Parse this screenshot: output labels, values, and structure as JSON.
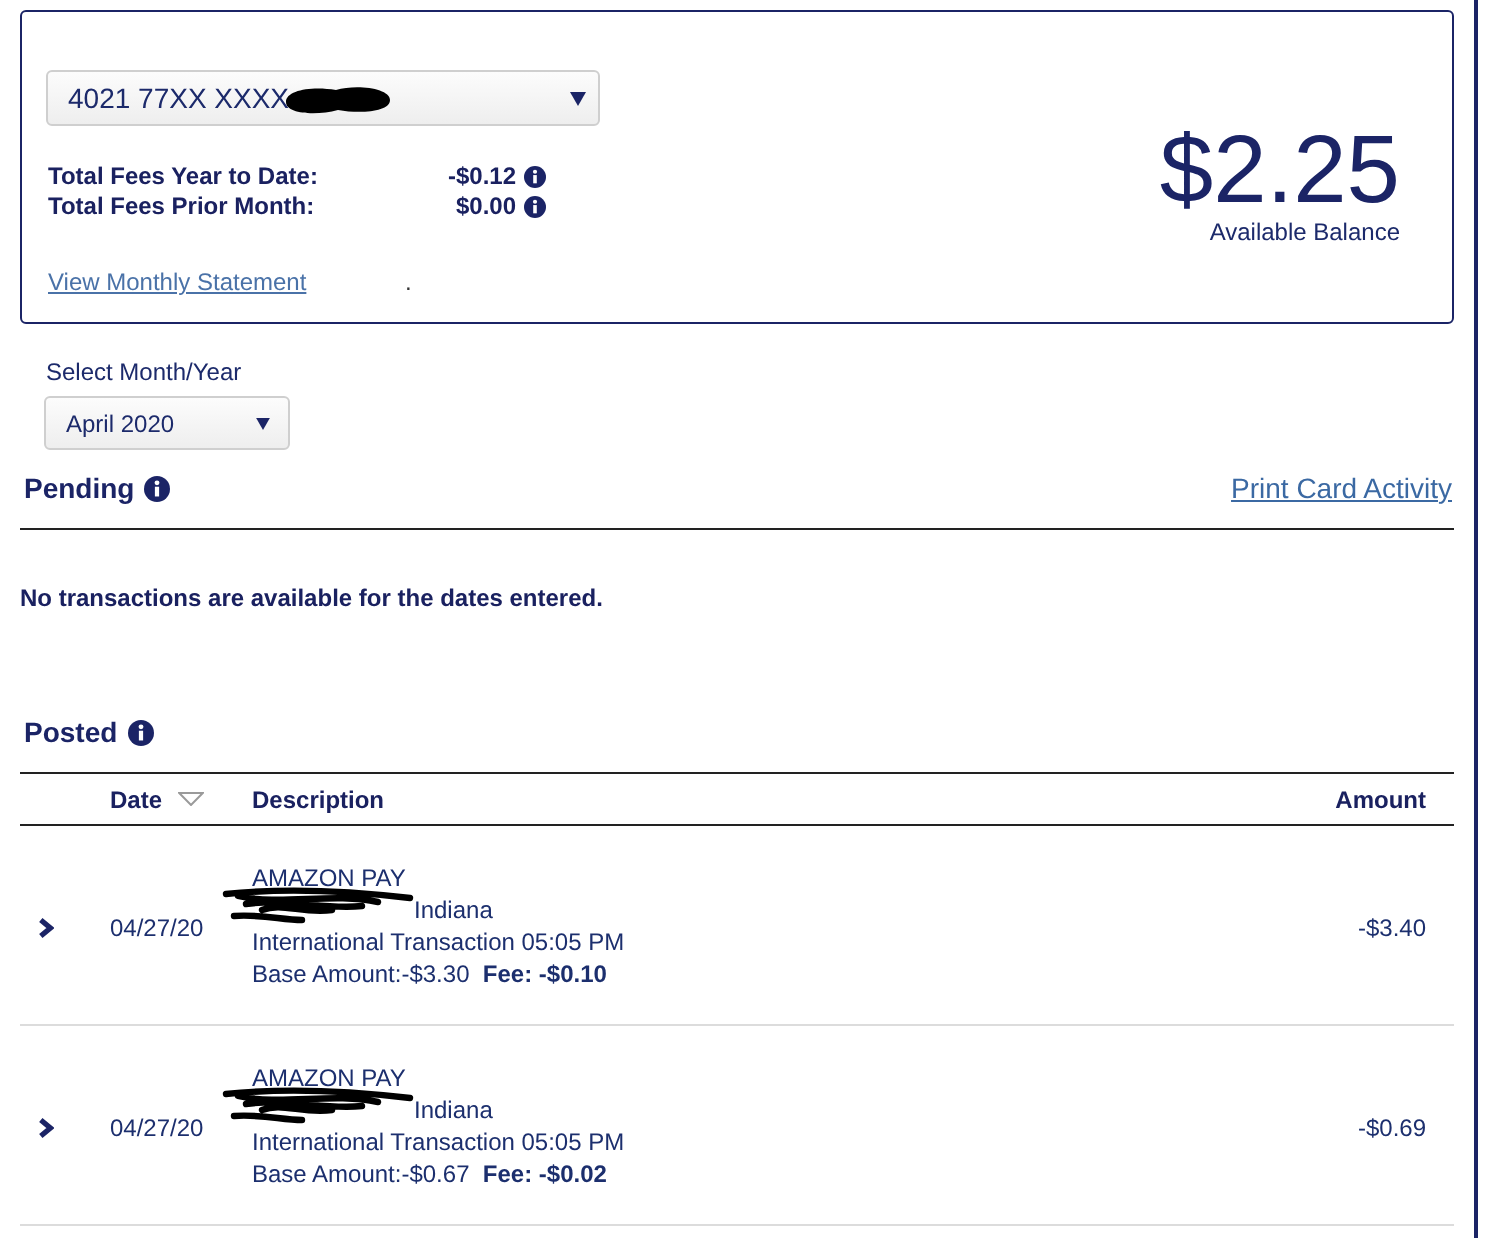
{
  "account_card": {
    "account_select": {
      "value": "4021 77XX XXXX",
      "redacted": true
    },
    "fees": [
      {
        "label": "Total Fees Year to Date:",
        "value": "-$0.12"
      },
      {
        "label": "Total Fees Prior Month:",
        "value": "$0.00"
      }
    ],
    "statement_link": "View Monthly Statement",
    "trailing_text": ".",
    "balance": {
      "amount": "$2.25",
      "label": "Available Balance"
    }
  },
  "month_filter": {
    "label": "Select Month/Year",
    "value": "April 2020"
  },
  "pending": {
    "title": "Pending",
    "print_link": "Print Card Activity",
    "empty_message": "No transactions are available for the dates entered."
  },
  "posted": {
    "title": "Posted",
    "columns": [
      {
        "label": "Date",
        "sorted": true
      },
      {
        "label": "Description",
        "sorted": false
      },
      {
        "label": "Amount",
        "sorted": false
      }
    ],
    "rows": [
      {
        "expanded": false,
        "date": "04/27/20",
        "merchant": "AMAZON PAY",
        "location": "Indiana",
        "location_redacted": true,
        "detail": "International Transaction 05:05 PM",
        "breakdown": "Base Amount:-$3.30  **Fee: -$0.10**",
        "amount": "-$3.40"
      },
      {
        "expanded": false,
        "date": "04/27/20",
        "merchant": "AMAZON PAY",
        "location": "Indiana",
        "location_redacted": true,
        "detail": "International Transaction 05:05 PM",
        "breakdown": "Base Amount:-$0.67  **Fee: -$0.02**",
        "amount": "-$0.69"
      }
    ]
  }
}
